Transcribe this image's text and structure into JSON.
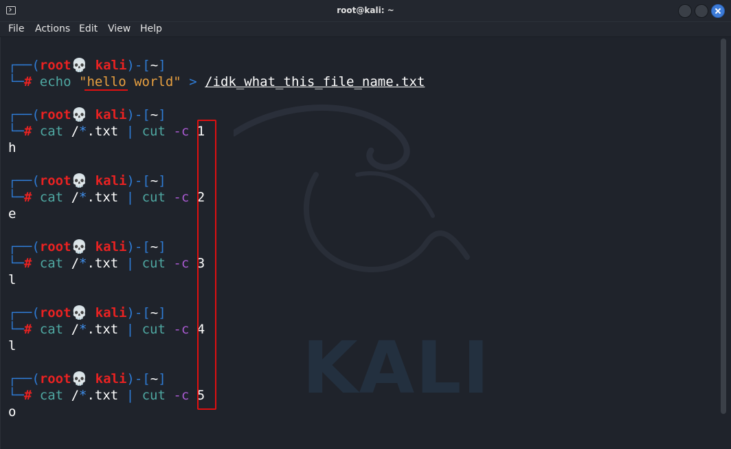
{
  "window": {
    "title": "root@kali: ~"
  },
  "menu": [
    "File",
    "Actions",
    "Edit",
    "View",
    "Help"
  ],
  "prompt": {
    "top_open": "┌──(",
    "user": "root",
    "sep": "💀",
    "host": "kali",
    "mid": ")-[",
    "dir": "~",
    "close": "]",
    "bottom": "└─",
    "hash": "#"
  },
  "first_command": {
    "cmd": "echo",
    "q1": "\"",
    "word1": "hello",
    "word2": " world\"",
    "redirect": ">",
    "file": "/idk_what_this_file_name.txt"
  },
  "cut_commands": [
    {
      "cat": "cat",
      "slash": "/",
      "star": "*",
      "ext": ".txt",
      "pipe": "|",
      "cut": "cut",
      "opt": "-c",
      "num": "1",
      "output": "h"
    },
    {
      "cat": "cat",
      "slash": "/",
      "star": "*",
      "ext": ".txt",
      "pipe": "|",
      "cut": "cut",
      "opt": "-c",
      "num": "2",
      "output": "e"
    },
    {
      "cat": "cat",
      "slash": "/",
      "star": "*",
      "ext": ".txt",
      "pipe": "|",
      "cut": "cut",
      "opt": "-c",
      "num": "3",
      "output": "l"
    },
    {
      "cat": "cat",
      "slash": "/",
      "star": "*",
      "ext": ".txt",
      "pipe": "|",
      "cut": "cut",
      "opt": "-c",
      "num": "4",
      "output": "l"
    },
    {
      "cat": "cat",
      "slash": "/",
      "star": "*",
      "ext": ".txt",
      "pipe": "|",
      "cut": "cut",
      "opt": "-c",
      "num": "5",
      "output": "o"
    }
  ],
  "watermark": "KALI",
  "colors": {
    "prompt_frame": "#2f7cd6",
    "root": "#ea2222",
    "command": "#4fa8a2",
    "string": "#e8a040",
    "option": "#a95ad0",
    "highlight": "#e01010"
  }
}
